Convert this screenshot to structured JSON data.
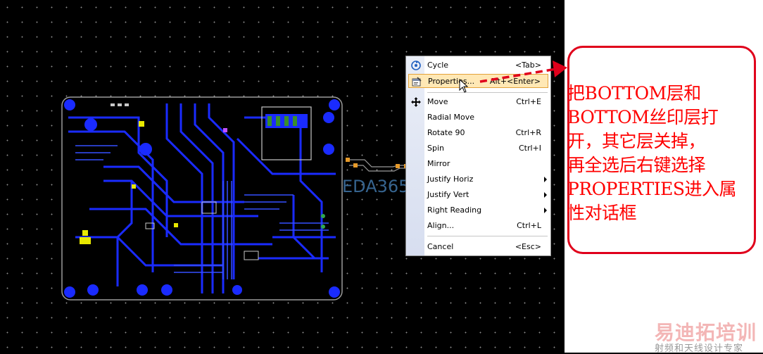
{
  "context_menu": {
    "items": [
      {
        "label": "Cycle",
        "shortcut": "<Tab>",
        "icon": "cycle-icon"
      },
      {
        "label": "Properties...",
        "shortcut": "Alt+<Enter>",
        "icon": "properties-icon",
        "highlighted": true
      },
      {
        "label": "Move",
        "shortcut": "Ctrl+E",
        "icon": "move-icon"
      },
      {
        "label": "Radial Move",
        "shortcut": ""
      },
      {
        "label": "Rotate 90",
        "shortcut": "Ctrl+R"
      },
      {
        "label": "Spin",
        "shortcut": "Ctrl+I"
      },
      {
        "label": "Mirror",
        "shortcut": ""
      },
      {
        "label": "Justify Horiz",
        "shortcut": "",
        "submenu": true
      },
      {
        "label": "Justify Vert",
        "shortcut": "",
        "submenu": true
      },
      {
        "label": "Right Reading",
        "shortcut": "",
        "submenu": true
      },
      {
        "label": "Align...",
        "shortcut": "Ctrl+L"
      },
      {
        "label": "Cancel",
        "shortcut": "<Esc>"
      }
    ]
  },
  "annotation": {
    "lines": [
      "把BOTTOM层和",
      "BOTTOM丝印层打",
      "开，其它层关掉，",
      "再全选后右键选择",
      "PROPERTIES进入属",
      "性对话框"
    ]
  },
  "watermark": {
    "center_text": "EDA365",
    "brand_main": "易迪拓培训",
    "brand_sub": "射频和天线设计专家"
  },
  "colors": {
    "board_trace": "#1a2bff",
    "highlight_bg": "#ffe8b5",
    "annotation_red": "#ff0000"
  }
}
